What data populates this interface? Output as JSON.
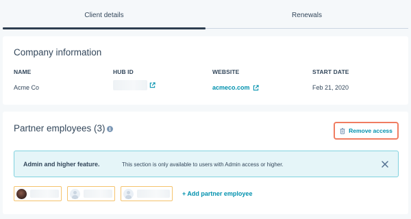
{
  "tabs": [
    {
      "label": "Client details",
      "active": true
    },
    {
      "label": "Renewals",
      "active": false
    }
  ],
  "company": {
    "title": "Company information",
    "columns": [
      {
        "header": "NAME",
        "value": "Acme Co"
      },
      {
        "header": "HUB ID",
        "value": ""
      },
      {
        "header": "WEBSITE",
        "value": "acmeco.com"
      },
      {
        "header": "START DATE",
        "value": "Feb 21, 2020"
      }
    ]
  },
  "partners": {
    "title": "Partner employees (3)",
    "remove_access_label": "Remove access",
    "banner": {
      "bold": "Admin and higher feature.",
      "text": "This section is only available to users with Admin access or higher."
    },
    "employees": [
      {
        "avatar": "photo"
      },
      {
        "avatar": "default-user-icon"
      },
      {
        "avatar": "default-user-icon"
      }
    ],
    "add_label": "+ Add partner employee"
  },
  "colors": {
    "link": "#0091ae",
    "highlight_border": "#f07c60",
    "chip_border": "#f5c26b",
    "banner_bg": "#e5f5f8",
    "text": "#33475b"
  },
  "icons": {
    "external_link": "external-link-icon",
    "info": "info-icon",
    "trash": "trash-icon",
    "close": "close-icon",
    "avatar": "user-avatar-icon"
  }
}
